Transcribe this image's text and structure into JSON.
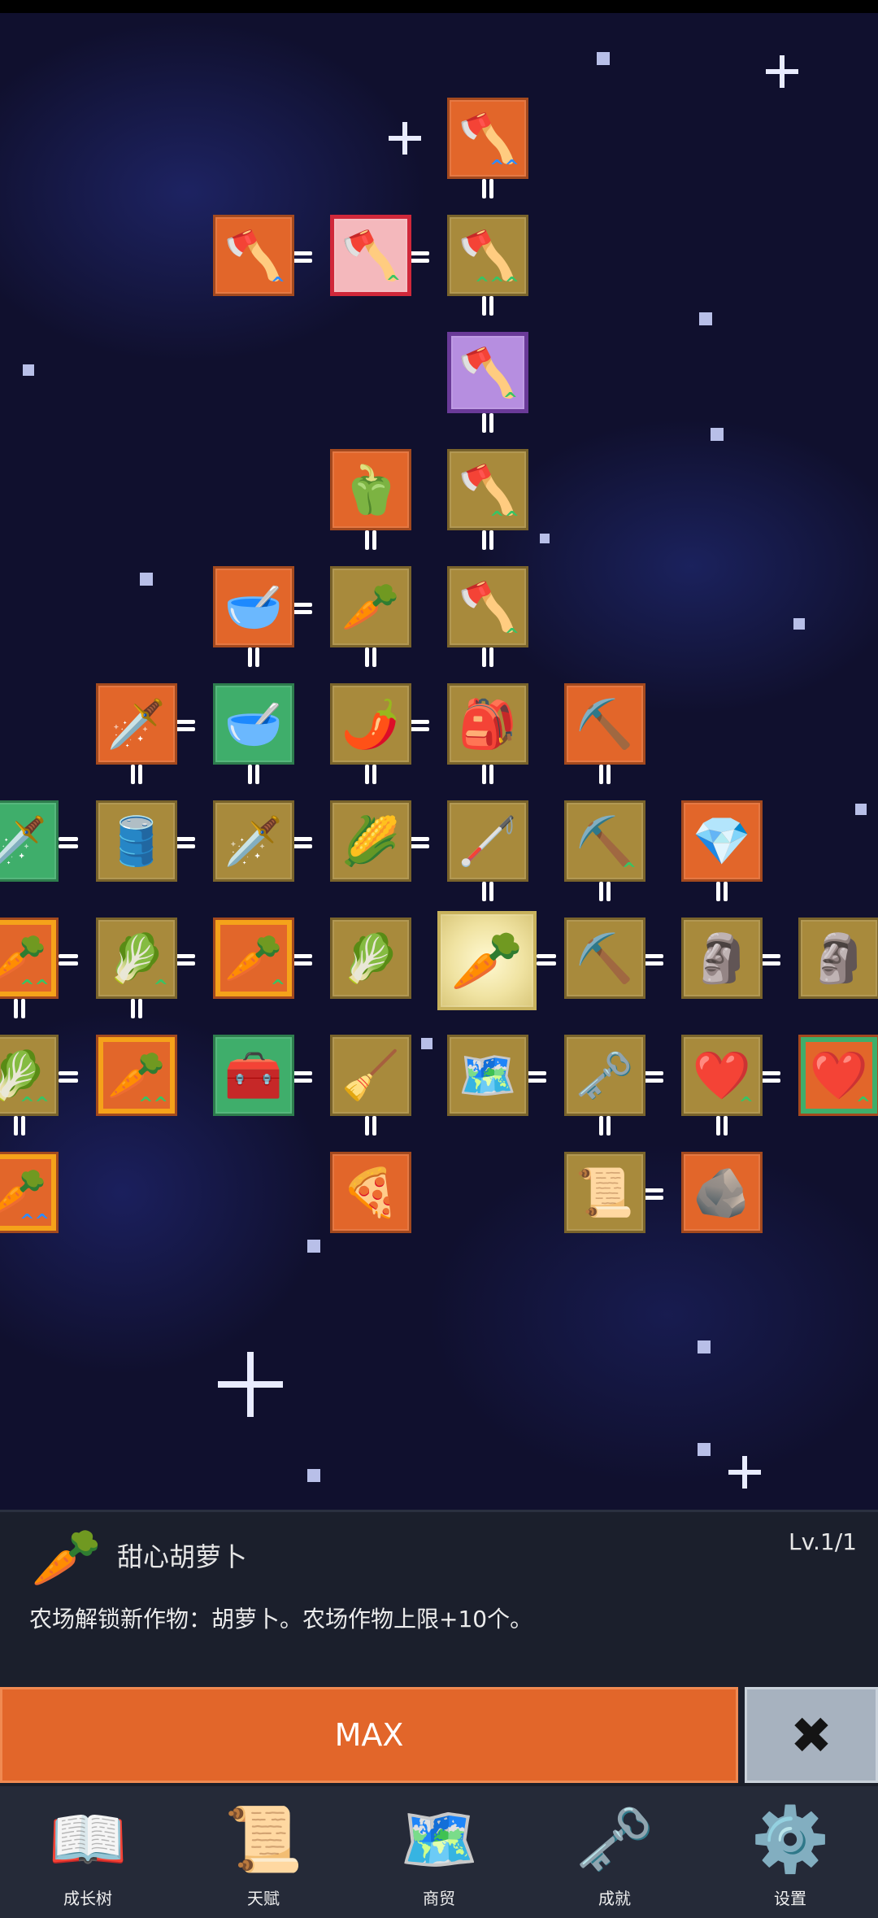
{
  "tree": {
    "nodes": [
      {
        "id": "shovel-top",
        "icon": "🪓",
        "chev": "^^",
        "chevColor": "blue"
      },
      {
        "id": "shovel-left",
        "icon": "🪓",
        "chev": "^",
        "chevColor": "blue"
      },
      {
        "id": "shovel-red",
        "icon": "🪓",
        "chev": "^",
        "chevColor": "green"
      },
      {
        "id": "shovel-mid",
        "icon": "🪓",
        "chev": "^^^",
        "chevColor": "green"
      },
      {
        "id": "shovel-purple",
        "icon": "🪓",
        "chev": "^",
        "chevColor": "green"
      },
      {
        "id": "pepper",
        "icon": "🫑",
        "chev": "",
        "chevColor": ""
      },
      {
        "id": "shovel-4",
        "icon": "🪓",
        "chev": "^^",
        "chevColor": "green"
      },
      {
        "id": "soup-bowl",
        "icon": "🥣",
        "chev": "",
        "chevColor": ""
      },
      {
        "id": "radish",
        "icon": "🥕",
        "chev": "",
        "chevColor": ""
      },
      {
        "id": "shovel-5",
        "icon": "🪓",
        "chev": "^",
        "chevColor": "green"
      },
      {
        "id": "golden-sword",
        "icon": "🗡️",
        "chev": "",
        "chevColor": ""
      },
      {
        "id": "bowl-green",
        "icon": "🥣",
        "chev": "",
        "chevColor": ""
      },
      {
        "id": "chili",
        "icon": "🌶️",
        "chev": "",
        "chevColor": ""
      },
      {
        "id": "backpack",
        "icon": "🎒",
        "chev": "",
        "chevColor": ""
      },
      {
        "id": "pickaxe-orange",
        "icon": "⛏️",
        "chev": "",
        "chevColor": ""
      },
      {
        "id": "sword-green",
        "icon": "🗡️",
        "chev": "",
        "chevColor": ""
      },
      {
        "id": "barrel",
        "icon": "🛢️",
        "chev": "",
        "chevColor": ""
      },
      {
        "id": "sword",
        "icon": "🗡️",
        "chev": "",
        "chevColor": ""
      },
      {
        "id": "corn",
        "icon": "🌽",
        "chev": "",
        "chevColor": ""
      },
      {
        "id": "stick",
        "icon": "🦯",
        "chev": "",
        "chevColor": ""
      },
      {
        "id": "pickaxe-1",
        "icon": "⛏️",
        "chev": "^",
        "chevColor": "green"
      },
      {
        "id": "crystal",
        "icon": "💎",
        "chev": "",
        "chevColor": ""
      },
      {
        "id": "carrot-edge",
        "icon": "🥕",
        "chev": "^^",
        "chevColor": "green"
      },
      {
        "id": "cabbage-1",
        "icon": "🥬",
        "chev": "^",
        "chevColor": "green"
      },
      {
        "id": "carrot-2",
        "icon": "🥕",
        "chev": "^",
        "chevColor": "green"
      },
      {
        "id": "cabbage-2",
        "icon": "🥬",
        "chev": "",
        "chevColor": ""
      },
      {
        "id": "carrot-selected",
        "icon": "🥕",
        "chev": "",
        "chevColor": ""
      },
      {
        "id": "pickaxe-2",
        "icon": "⛏️",
        "chev": "",
        "chevColor": ""
      },
      {
        "id": "statue-1",
        "icon": "🗿",
        "chev": "",
        "chevColor": ""
      },
      {
        "id": "statue-2",
        "icon": "🗿",
        "chev": "",
        "chevColor": ""
      },
      {
        "id": "cabbage-edge",
        "icon": "🥬",
        "chev": "^^",
        "chevColor": "green"
      },
      {
        "id": "carrot-3",
        "icon": "🥕",
        "chev": "^^",
        "chevColor": "green"
      },
      {
        "id": "chest",
        "icon": "🧰",
        "chev": "",
        "chevColor": ""
      },
      {
        "id": "broom",
        "icon": "🧹",
        "chev": "",
        "chevColor": ""
      },
      {
        "id": "map",
        "icon": "🗺️",
        "chev": "",
        "chevColor": ""
      },
      {
        "id": "key",
        "icon": "🗝️",
        "chev": "",
        "chevColor": ""
      },
      {
        "id": "heart-1",
        "icon": "❤️",
        "chev": "^",
        "chevColor": "green"
      },
      {
        "id": "heart-2",
        "icon": "❤️",
        "chev": "^",
        "chevColor": "green"
      },
      {
        "id": "carrot-edge-2",
        "icon": "🥕",
        "chev": "^^",
        "chevColor": "blue"
      },
      {
        "id": "pizza",
        "icon": "🍕",
        "chev": "",
        "chevColor": ""
      },
      {
        "id": "scroll",
        "icon": "📜",
        "chev": "",
        "chevColor": ""
      },
      {
        "id": "fossil",
        "icon": "🪨",
        "chev": "",
        "chevColor": ""
      }
    ]
  },
  "selected": {
    "icon": "🥕",
    "name": "甜心胡萝卜",
    "level": "Lv.1/1",
    "description": "农场解锁新作物：胡萝卜。农场作物上限+10个。"
  },
  "actions": {
    "max_label": "MAX",
    "close_glyph": "✖"
  },
  "nav": [
    {
      "icon": "📖",
      "label": "成长树"
    },
    {
      "icon": "📜",
      "label": "天赋"
    },
    {
      "icon": "🗺️",
      "label": "商贸"
    },
    {
      "icon": "🗝️",
      "label": "成就"
    },
    {
      "icon": "⚙️",
      "label": "设置"
    }
  ]
}
